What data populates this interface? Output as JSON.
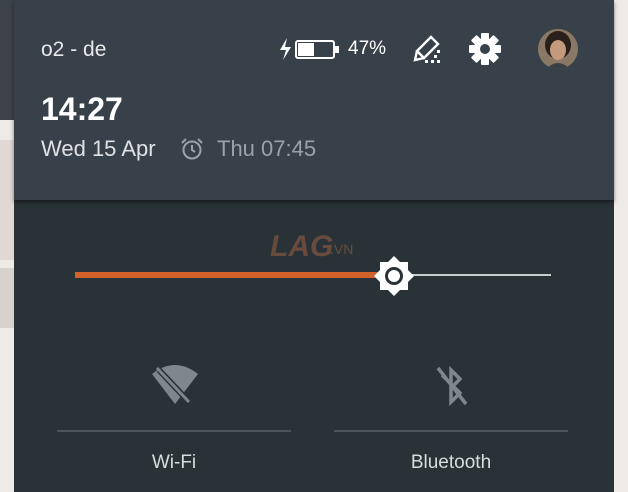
{
  "status_bar": {
    "carrier": "o2 - de",
    "battery_percent": "47%",
    "battery_level": 0.47,
    "charging": true
  },
  "header": {
    "time": "14:27",
    "date": "Wed 15 Apr",
    "next_alarm": "Thu 07:45"
  },
  "brightness": {
    "level": 0.67,
    "accent_color": "#d2622c"
  },
  "tiles": [
    {
      "label": "Wi-Fi",
      "icon": "wifi-off-icon"
    },
    {
      "label": "Bluetooth",
      "icon": "bluetooth-off-icon"
    }
  ],
  "watermark": "LAG.VN"
}
